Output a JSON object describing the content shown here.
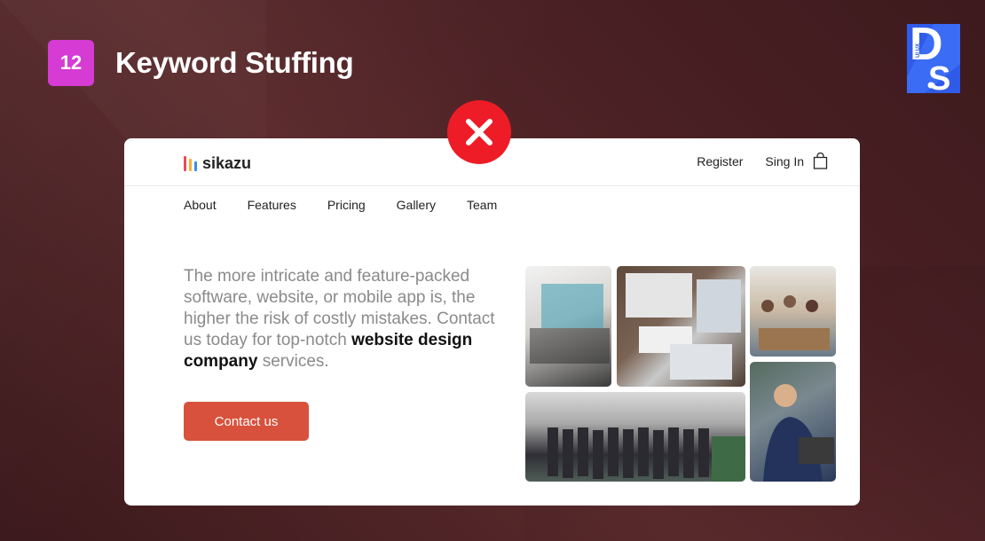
{
  "slide": {
    "number": "12",
    "title": "Keyword Stuffing",
    "brand_logo_text": "UI UX DS",
    "verdict_icon": "close-icon",
    "colors": {
      "badge": "#d63bd3",
      "verdict": "#ee1c27",
      "background": "#4a2024",
      "brand": "#2f5be8"
    }
  },
  "site": {
    "logo_name": "sikazu",
    "logo_bar_colors": [
      "#e84b5a",
      "#f4b23a",
      "#3a8ee6"
    ],
    "header": {
      "register": "Register",
      "sign_in": "Sing In",
      "cart_icon": "shopping-bag-icon"
    },
    "nav": [
      "About",
      "Features",
      "Pricing",
      "Gallery",
      "Team"
    ],
    "copy": {
      "intro": "The more intricate and feature-packed software, website, or mobile app is, the higher the risk of costly mistakes. Contact us today for top-notch",
      "keyword": "website design company",
      "outro": " services."
    },
    "cta_label": "Contact us",
    "cta_color": "#d8513c",
    "photos": [
      "laptop-user-photo",
      "desk-devices-photo",
      "team-meeting-photo",
      "group-office-photo",
      "man-laptop-photo"
    ]
  }
}
